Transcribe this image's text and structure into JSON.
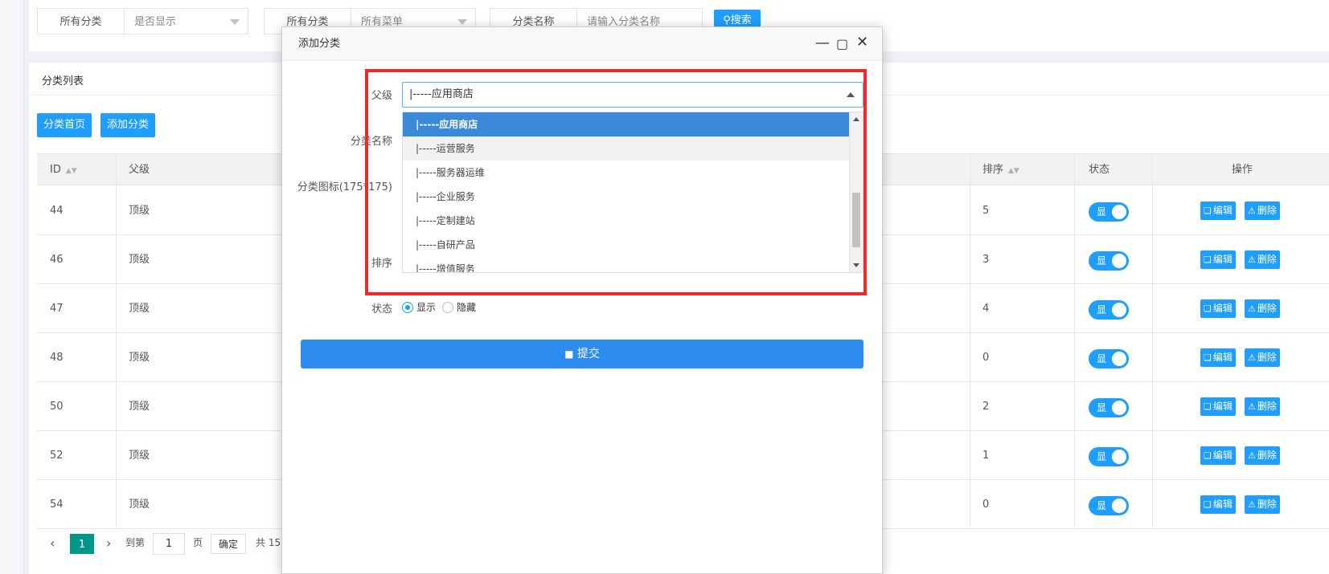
{
  "filters": [
    {
      "label": "所有分类",
      "value": "是否显示"
    },
    {
      "label": "所有分类",
      "value": "所有菜单"
    },
    {
      "label": "分类名称",
      "placeholder": "请输入分类名称"
    }
  ],
  "search_label": "搜索",
  "panel_title": "分类列表",
  "toolbar": {
    "home_label": "分类首页",
    "add_label": "添加分类"
  },
  "table": {
    "headers": {
      "id": "ID",
      "parent": "父级",
      "sort": "排序",
      "status": "状态",
      "ops": "操作"
    },
    "rows": [
      {
        "id": "44",
        "parent": "顶级",
        "sort": "5"
      },
      {
        "id": "46",
        "parent": "顶级",
        "sort": "3"
      },
      {
        "id": "47",
        "parent": "顶级",
        "sort": "4"
      },
      {
        "id": "48",
        "parent": "顶级",
        "sort": "0"
      },
      {
        "id": "50",
        "parent": "顶级",
        "sort": "2"
      },
      {
        "id": "52",
        "parent": "顶级",
        "sort": "1"
      },
      {
        "id": "54",
        "parent": "顶级",
        "sort": "0"
      }
    ],
    "status_on_label": "显",
    "edit_label": "编辑",
    "delete_label": "删除"
  },
  "pager": {
    "current": "1",
    "goto_label": "到第",
    "page_input": "1",
    "page_unit": "页",
    "confirm_label": "确定",
    "total_text": "共 15"
  },
  "modal": {
    "title": "添加分类",
    "labels": {
      "parent": "父级",
      "name": "分类名称",
      "icon": "分类图标(175*175)",
      "sort": "排序",
      "status": "状态"
    },
    "parent_value": "|-----应用商店",
    "options": [
      "|-----应用商店",
      "|-----运营服务",
      "|-----服务器运维",
      "|-----企业服务",
      "|-----定制建站",
      "|-----自研产品",
      "|-----增值服务"
    ],
    "radio_show": "显示",
    "radio_hide": "隐藏",
    "submit_label": "提交"
  },
  "colors": {
    "accent": "#1e9fff",
    "highlight": "#ee2a2a",
    "selected_option": "#3b8ad9",
    "submit": "#2d8cf0"
  }
}
